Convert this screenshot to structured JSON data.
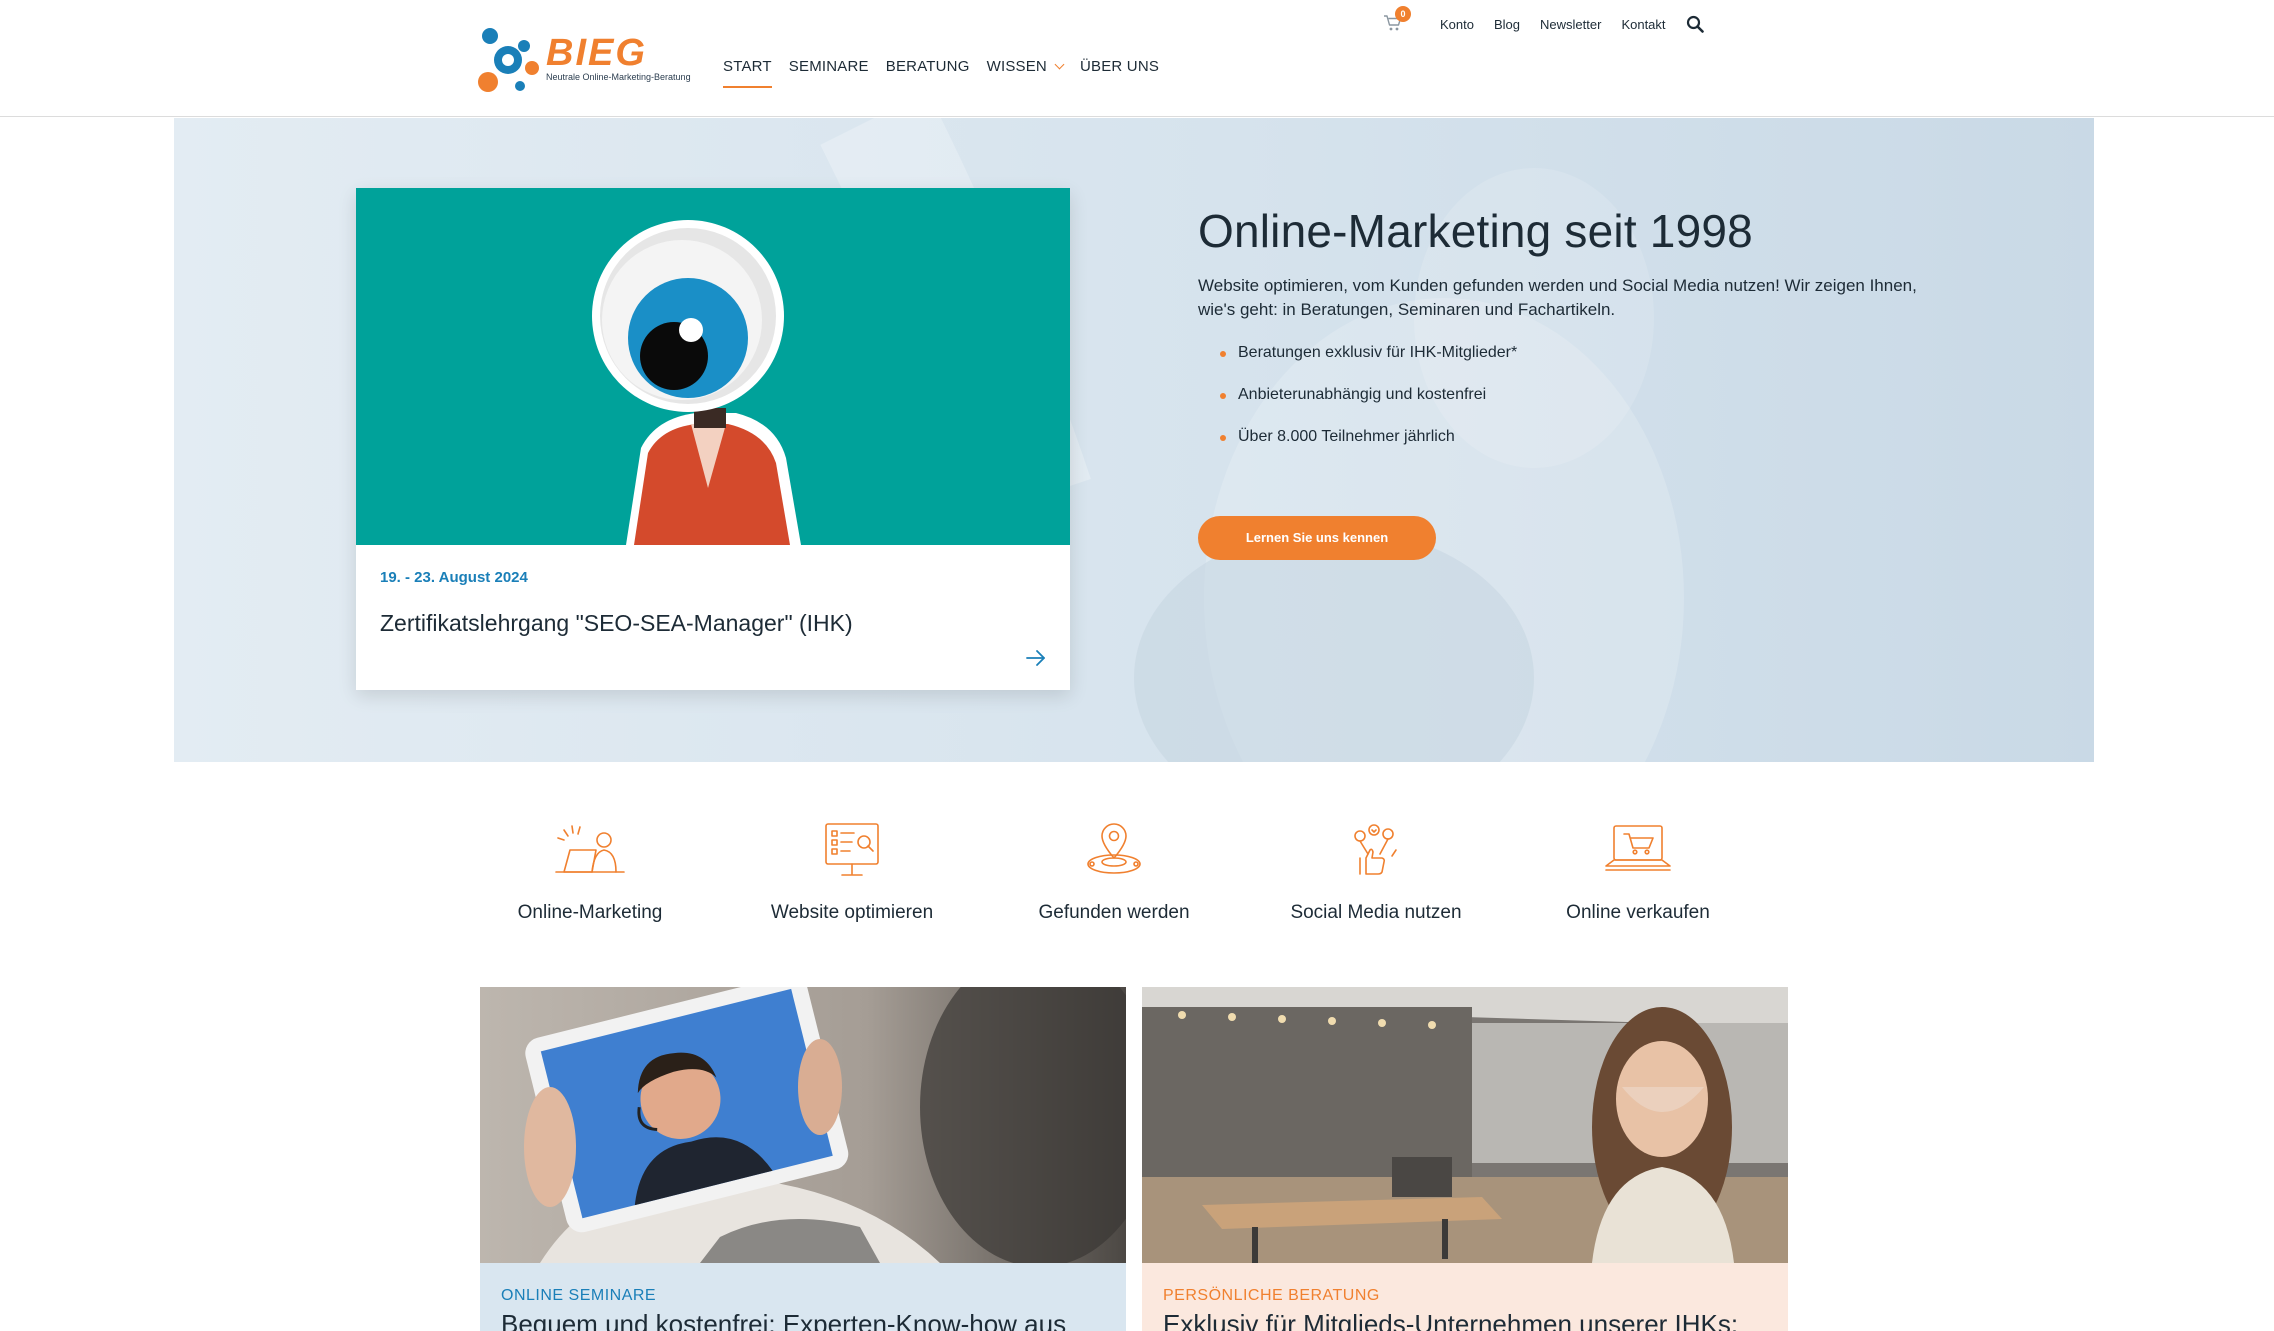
{
  "header": {
    "logo_text": "BIEG",
    "logo_subtitle": "Neutrale Online-Marketing-Beratung",
    "nav": [
      {
        "label": "START",
        "active": true
      },
      {
        "label": "SEMINARE"
      },
      {
        "label": "BERATUNG"
      },
      {
        "label": "WISSEN",
        "has_dropdown": true
      },
      {
        "label": "ÜBER UNS"
      }
    ],
    "cart_count": "0",
    "utility_links": [
      "Konto",
      "Blog",
      "Newsletter",
      "Kontakt"
    ],
    "search_icon": "search-icon"
  },
  "hero": {
    "card": {
      "date": "19. - 23. August 2024",
      "title": "Zertifikatslehrgang \"SEO-SEA-Manager\" (IHK)"
    },
    "title": "Online-Marketing seit 1998",
    "lead": "Website optimieren, vom Kunden gefunden werden und Social Media nutzen! Wir zeigen Ihnen, wie's geht: in Beratungen, Seminaren und Fachartikeln.",
    "bullets": [
      "Beratungen exklusiv für IHK-Mitglieder*",
      "Anbieterunabhängig und kostenfrei",
      "Über 8.000 Teilnehmer jährlich"
    ],
    "cta": "Lernen Sie uns kennen"
  },
  "topics": [
    {
      "label": "Online-Marketing",
      "icon": "laptop-person-icon"
    },
    {
      "label": "Website optimieren",
      "icon": "monitor-checklist-icon"
    },
    {
      "label": "Gefunden werden",
      "icon": "map-pin-icon"
    },
    {
      "label": "Social Media nutzen",
      "icon": "social-likes-icon"
    },
    {
      "label": "Online verkaufen",
      "icon": "laptop-cart-icon"
    }
  ],
  "tiles": [
    {
      "kicker": "ONLINE SEMINARE",
      "heading": "Bequem und kostenfrei: Experten-Know-how aus"
    },
    {
      "kicker": "PERSÖNLICHE BERATUNG",
      "heading": "Exklusiv für Mitglieds-Unternehmen unserer IHKs:"
    }
  ],
  "colors": {
    "accent": "#f0802f",
    "link_blue": "#1a7fb8",
    "teal": "#00a29a",
    "tile1_bg": "#d9e6f0",
    "tile2_bg": "#fbe8de"
  }
}
